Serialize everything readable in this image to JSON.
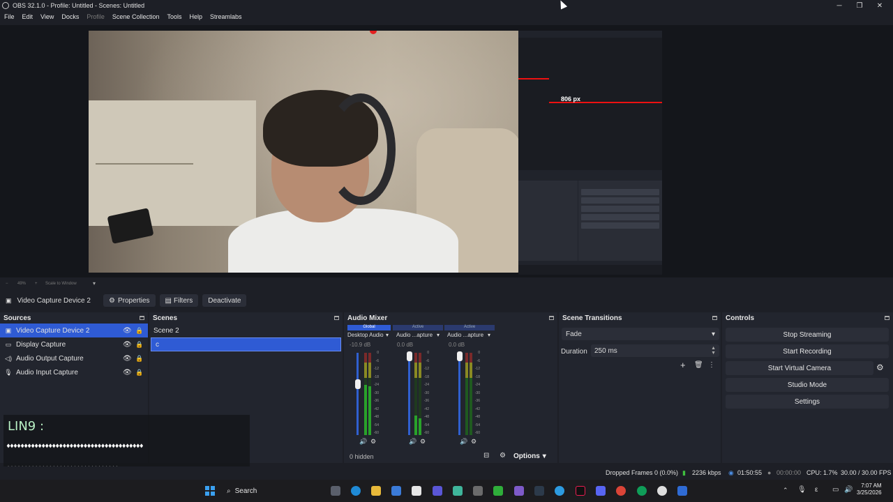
{
  "window": {
    "title": "OBS 32.1.0 - Profile: Untitled - Scenes: Untitled",
    "minimize": "─",
    "maximize": "❐",
    "close": "✕"
  },
  "menu": [
    "File",
    "Edit",
    "View",
    "Docks",
    "Profile",
    "Scene Collection",
    "Tools",
    "Help",
    "Streamlabs"
  ],
  "preview": {
    "measure_label": "806 px",
    "zoom_value": "49%",
    "zoom_plus": "+",
    "zoom_minus": "−",
    "scale_label": "Scale to Window",
    "mini_buttons": [
      "Stop Streaming",
      "Start Recording",
      "Start Virtual Camera",
      "Studio Mode",
      "Settings"
    ]
  },
  "source_toolbar": {
    "current_source": "Video Capture Device 2",
    "properties": "Properties",
    "filters": "Filters",
    "deactivate": "Deactivate"
  },
  "sources": {
    "title": "Sources",
    "items": [
      {
        "label": "Video Capture Device 2",
        "icon": "camera-icon",
        "glyph": "▣"
      },
      {
        "label": "Display Capture",
        "icon": "monitor-icon",
        "glyph": "▭"
      },
      {
        "label": "Audio Output Capture",
        "icon": "speaker-icon",
        "glyph": "◁)"
      },
      {
        "label": "Audio Input Capture",
        "icon": "microphone-icon",
        "glyph": "🎙"
      }
    ]
  },
  "scenes": {
    "title": "Scenes",
    "items": [
      "Scene 2",
      "c"
    ]
  },
  "audio_mixer": {
    "title": "Audio Mixer",
    "tabs": [
      "Global",
      "Active",
      "Active"
    ],
    "channels": [
      {
        "name": "Desktop Audio",
        "db": "-10.9 dB",
        "level": 0.55
      },
      {
        "name": "Audio ...apture",
        "db": "0.0 dB",
        "level": 0.2
      },
      {
        "name": "Audio ...apture",
        "db": "0.0 dB",
        "level": 0.0
      }
    ],
    "scale": [
      "0",
      "-6",
      "-12",
      "-18",
      "-24",
      "-30",
      "-36",
      "-42",
      "-48",
      "-54",
      "-60"
    ],
    "hidden": "0 hidden",
    "options": "Options"
  },
  "transitions": {
    "title": "Scene Transitions",
    "selected": "Fade",
    "duration_label": "Duration",
    "duration_value": "250 ms"
  },
  "controls": {
    "title": "Controls",
    "buttons": [
      "Stop Streaming",
      "Start Recording",
      "Start Virtual Camera",
      "Studio Mode",
      "Settings"
    ]
  },
  "chat_overlay": {
    "name": "LIN9 :",
    "line1": "♦♦♦♦♦♦♦♦♦♦♦♦♦♦♦♦♦♦♦♦♦♦♦♦♦♦♦♦♦♦♦♦♦♦♦♦♦♦♦",
    "line2": "♦♦♦♦♦♦♦♦♦♦♦♦♦♦♦♦♦♦♦♦♦♦♦♦♦♦♦♦♦♦♦♦"
  },
  "status": {
    "dropped": "Dropped Frames 0 (0.0%)",
    "bitrate": "2236 kbps",
    "stream_time": "01:50:55",
    "rec_time": "00:00:00",
    "cpu": "CPU: 1.7%",
    "fps": "30.00 / 30.00 FPS"
  },
  "taskbar": {
    "search": "Search",
    "time": "7:07 AM",
    "date": "3/25/2026"
  },
  "colors": {
    "accent": "#2f5bd4",
    "recording_red": "#e32020",
    "meter_green": "#29a32a"
  }
}
